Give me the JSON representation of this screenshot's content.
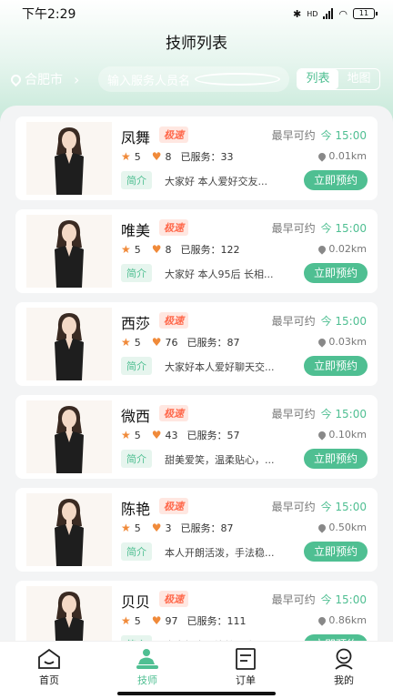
{
  "status_bar": {
    "time": "下午2:29",
    "battery": "11",
    "hd": "HD"
  },
  "page_title": "技师列表",
  "city": "合肥市",
  "search": {
    "placeholder": "输入服务人员名称或关键"
  },
  "view_toggle": {
    "list": "列表",
    "map": "地图",
    "selected": "list"
  },
  "card_labels": {
    "earliest": "最早可约",
    "served": "已服务：",
    "intro": "简介",
    "book": "立即预约"
  },
  "technicians": [
    {
      "name": "凤舞",
      "tag": "极速",
      "rating": "5",
      "likes": "8",
      "served": "33",
      "earliest_time": "今 15:00",
      "distance": "0.01km",
      "intro": "大家好 本人爱好交友..."
    },
    {
      "name": "唯美",
      "tag": "极速",
      "rating": "5",
      "likes": "8",
      "served": "122",
      "earliest_time": "今 15:00",
      "distance": "0.02km",
      "intro": "大家好 本人95后 长相..."
    },
    {
      "name": "西莎",
      "tag": "极速",
      "rating": "5",
      "likes": "76",
      "served": "87",
      "earliest_time": "今 15:00",
      "distance": "0.03km",
      "intro": "大家好本人爱好聊天交..."
    },
    {
      "name": "微西",
      "tag": "极速",
      "rating": "5",
      "likes": "43",
      "served": "57",
      "earliest_time": "今 15:00",
      "distance": "0.10km",
      "intro": "甜美爱笑，温柔贴心，..."
    },
    {
      "name": "陈艳",
      "tag": "极速",
      "rating": "5",
      "likes": "3",
      "served": "87",
      "earliest_time": "今 15:00",
      "distance": "0.50km",
      "intro": "本人开朗活泼，手法稳..."
    },
    {
      "name": "贝贝",
      "tag": "极速",
      "rating": "5",
      "likes": "97",
      "served": "111",
      "earliest_time": "今 15:00",
      "distance": "0.86km",
      "intro": "大家好本人比较理疗..."
    }
  ],
  "tabbar": [
    {
      "label": "首页",
      "icon": "home-icon",
      "active": false
    },
    {
      "label": "技师",
      "icon": "technician-icon",
      "active": true
    },
    {
      "label": "订单",
      "icon": "order-icon",
      "active": false
    },
    {
      "label": "我的",
      "icon": "profile-icon",
      "active": false
    }
  ],
  "colors": {
    "accent": "#4fbf92",
    "tag": "#ff6a4d",
    "star": "#f08a3a"
  }
}
